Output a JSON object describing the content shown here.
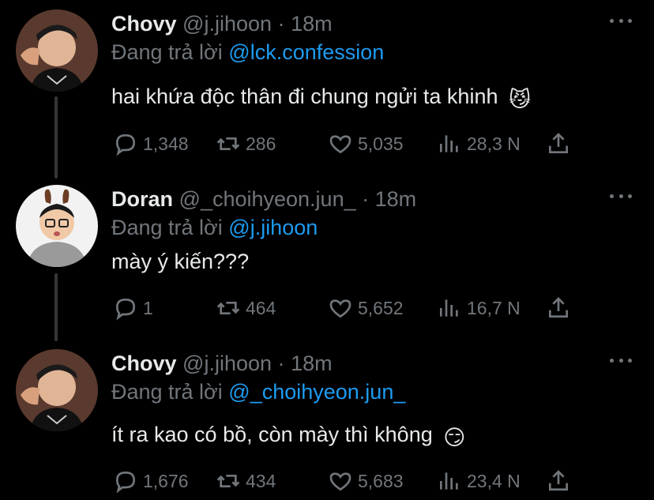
{
  "tweets": [
    {
      "name": "Chovy",
      "handle": "@j.jihoon",
      "dot": "·",
      "time": "18m",
      "reply_prefix": "Đang trả lời",
      "reply_to": "@lck.confession",
      "text": "hai khứa độc thân đi chung ngửi ta khinh",
      "emoji": "😼",
      "replies": "1,348",
      "retweets": "286",
      "likes": "5,035",
      "views": "28,3 N"
    },
    {
      "name": "Doran",
      "handle": "@_choihyeon.jun_",
      "dot": "·",
      "time": "18m",
      "reply_prefix": "Đang trả lời",
      "reply_to": "@j.jihoon",
      "text": "mày ý kiến???",
      "emoji": "",
      "replies": "1",
      "retweets": "464",
      "likes": "5,652",
      "views": "16,7 N"
    },
    {
      "name": "Chovy",
      "handle": "@j.jihoon",
      "dot": "·",
      "time": "18m",
      "reply_prefix": "Đang trả lời",
      "reply_to": "@_choihyeon.jun_",
      "text": "ít ra kao có bồ, còn mày thì không",
      "emoji": "😏",
      "replies": "1,676",
      "retweets": "434",
      "likes": "5,683",
      "views": "23,4 N"
    }
  ],
  "icons": {
    "reply": "reply-icon",
    "retweet": "retweet-icon",
    "like": "heart-icon",
    "views": "views-icon",
    "share": "share-icon",
    "more": "more-icon"
  },
  "colors": {
    "background": "#000000",
    "text": "#e7e9ea",
    "muted": "#71767b",
    "mention": "#1d9bf0"
  }
}
